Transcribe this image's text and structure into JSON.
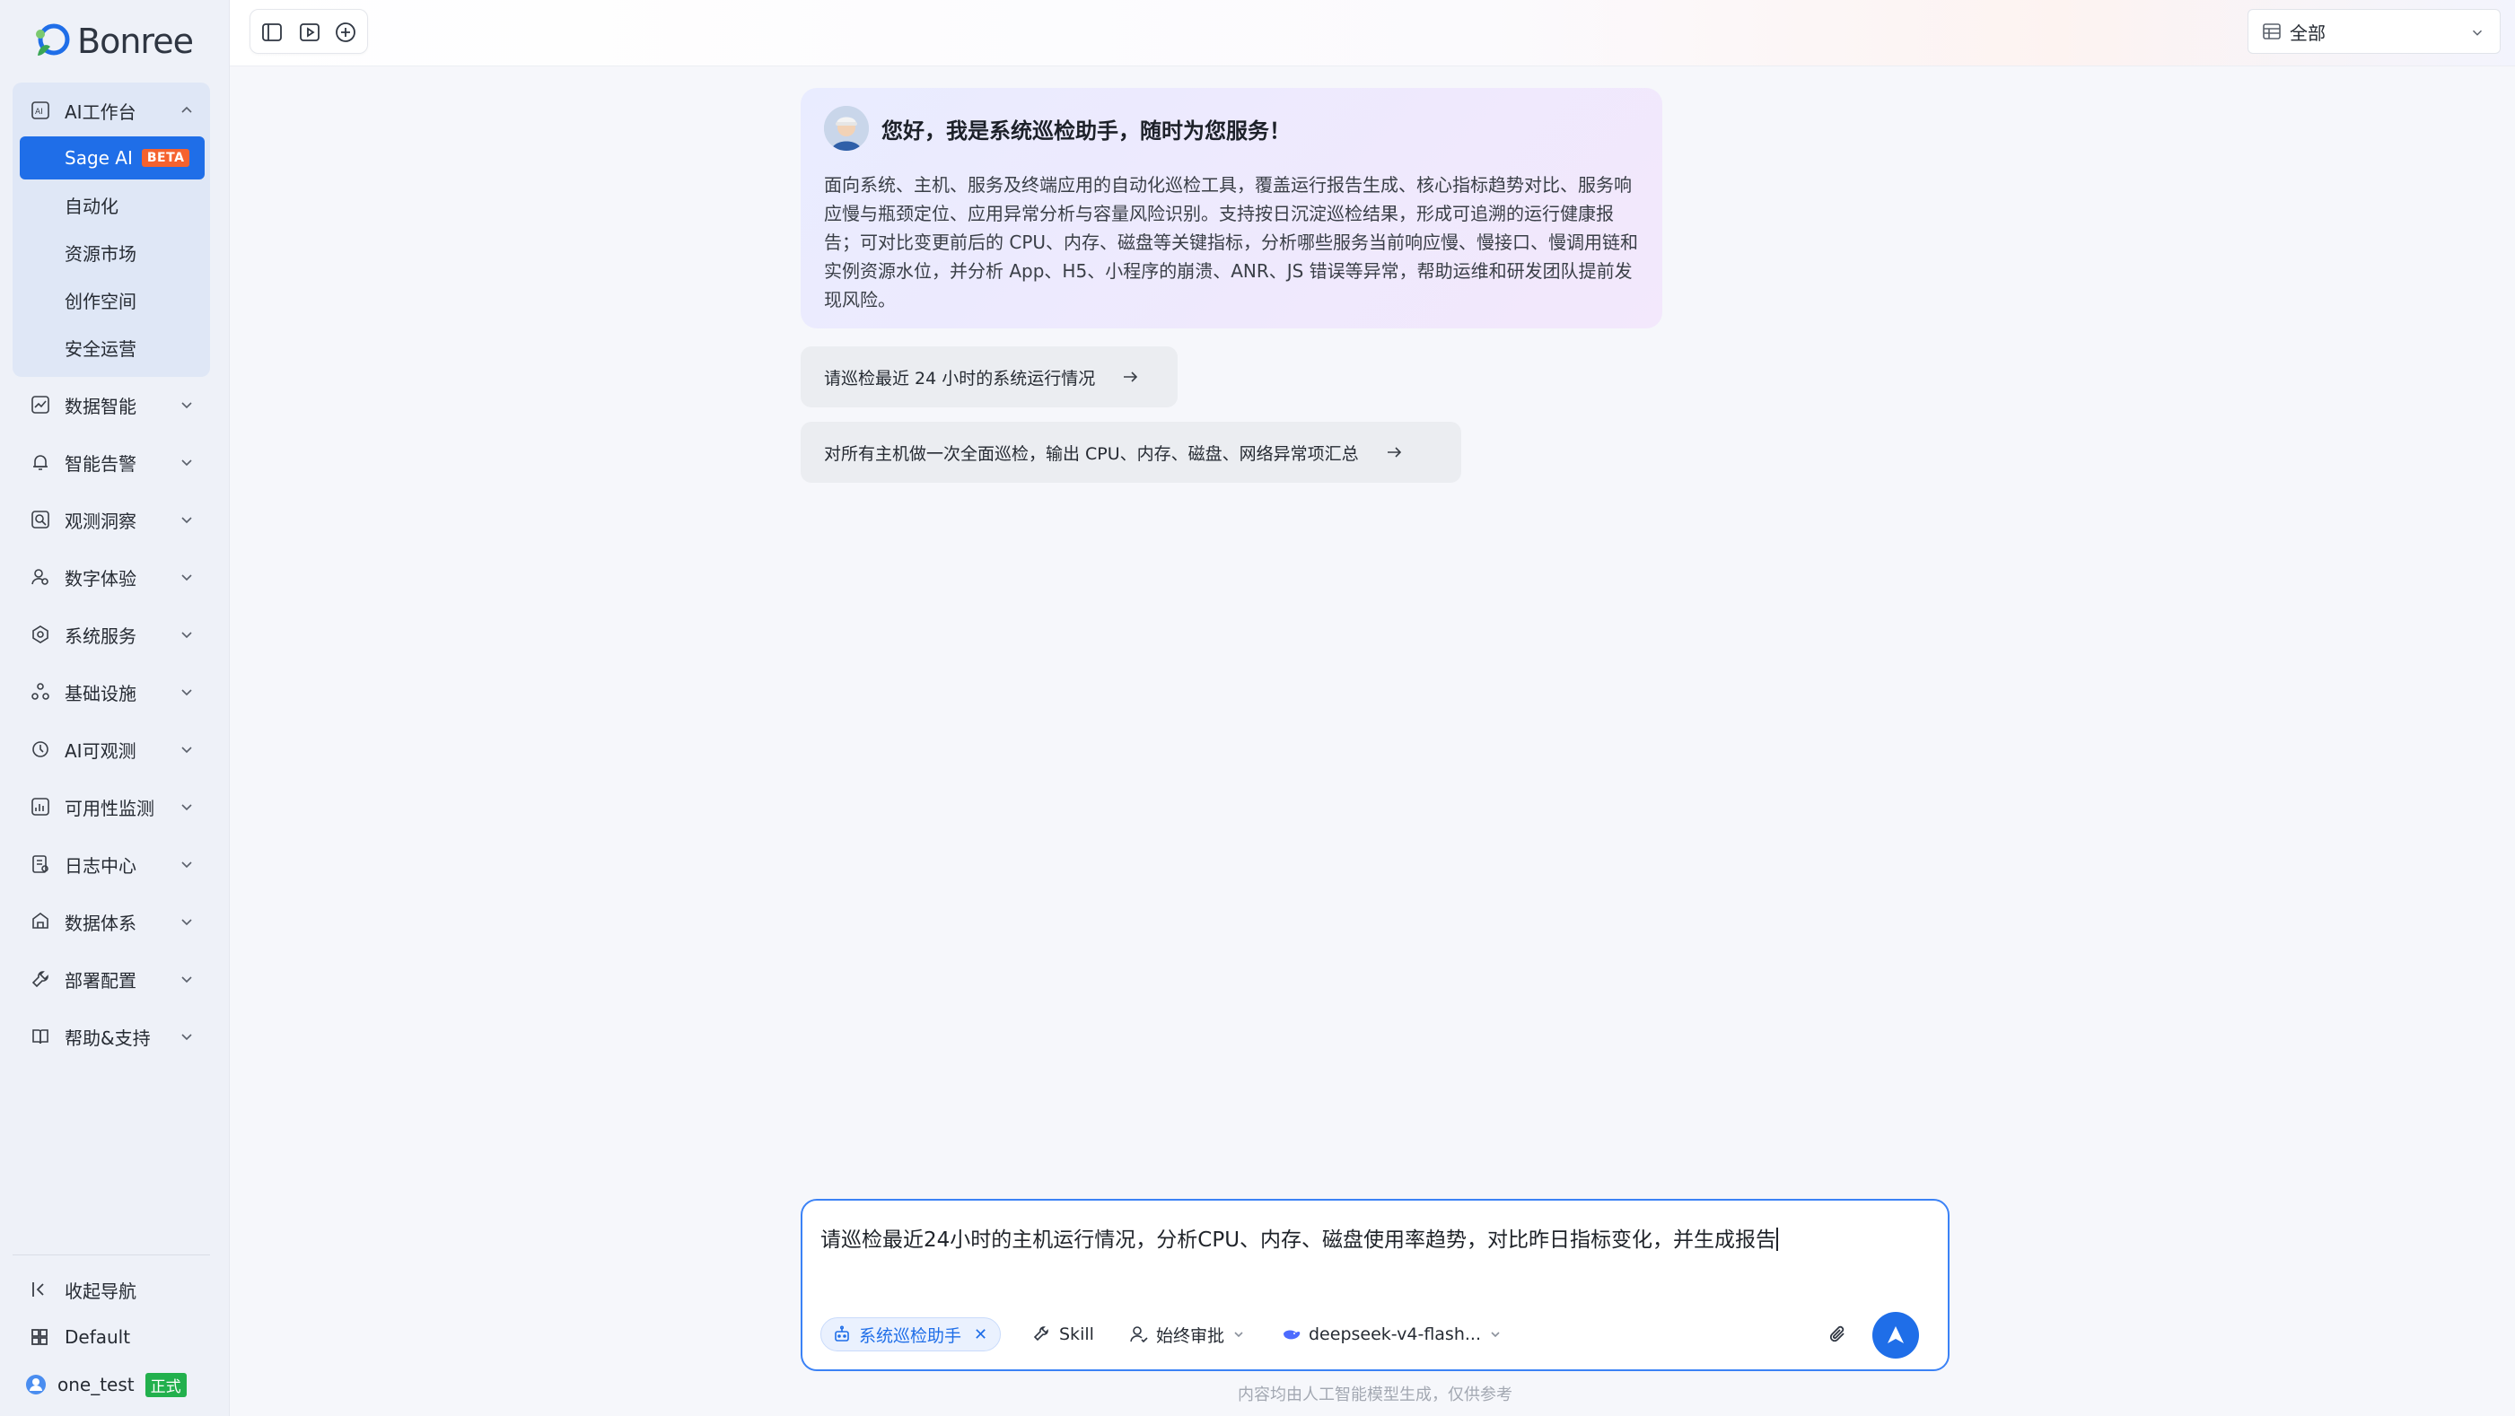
{
  "brand": {
    "name": "Bonree"
  },
  "sidebar": {
    "workbench": {
      "label": "AI工作台"
    },
    "sub_items": [
      {
        "label": "Sage AI",
        "badge": "BETA",
        "active": true
      },
      {
        "label": "自动化"
      },
      {
        "label": "资源市场"
      },
      {
        "label": "创作空间"
      },
      {
        "label": "安全运营"
      }
    ],
    "items": [
      {
        "label": "数据智能",
        "icon": "chart-line-icon"
      },
      {
        "label": "智能告警",
        "icon": "alarm-icon"
      },
      {
        "label": "观测洞察",
        "icon": "magnify-icon"
      },
      {
        "label": "数字体验",
        "icon": "user-experience-icon"
      },
      {
        "label": "系统服务",
        "icon": "service-icon"
      },
      {
        "label": "基础设施",
        "icon": "infrastructure-icon"
      },
      {
        "label": "AI可观测",
        "icon": "ai-observe-icon"
      },
      {
        "label": "可用性监测",
        "icon": "availability-icon"
      },
      {
        "label": "日志中心",
        "icon": "log-icon"
      },
      {
        "label": "数据体系",
        "icon": "data-system-icon"
      },
      {
        "label": "部署配置",
        "icon": "wrench-icon"
      },
      {
        "label": "帮助&支持",
        "icon": "book-icon"
      }
    ],
    "footer": {
      "collapse_label": "收起导航",
      "workspace_label": "Default",
      "user_name": "one_test",
      "user_tag": "正式"
    }
  },
  "topbar": {
    "scope_select": {
      "value": "全部"
    }
  },
  "welcome": {
    "title": "您好，我是系统巡检助手，随时为您服务！",
    "description": "面向系统、主机、服务及终端应用的自动化巡检工具，覆盖运行报告生成、核心指标趋势对比、服务响应慢与瓶颈定位、应用异常分析与容量风险识别。支持按日沉淀巡检结果，形成可追溯的运行健康报告；可对比变更前后的 CPU、内存、磁盘等关键指标，分析哪些服务当前响应慢、慢接口、慢调用链和实例资源水位，并分析 App、H5、小程序的崩溃、ANR、JS 错误等异常，帮助运维和研发团队提前发现风险。"
  },
  "suggestions": [
    {
      "text": "请巡检最近 24 小时的系统运行情况"
    },
    {
      "text": "对所有主机做一次全面巡检，输出 CPU、内存、磁盘、网络异常项汇总"
    }
  ],
  "composer": {
    "value": "请巡检最近24小时的主机运行情况，分析CPU、内存、磁盘使用率趋势，对比昨日指标变化，并生成报告",
    "agent_chip": "系统巡检助手",
    "skill_label": "Skill",
    "approval_label": "始终审批",
    "model_label": "deepseek-v4-flash..."
  },
  "disclaimer": "内容均由人工智能模型生成，仅供参考",
  "colors": {
    "accent": "#1f6ee8",
    "beta": "#f5622e",
    "tag_green": "#22b04d",
    "composer_border": "#3b82f6"
  }
}
